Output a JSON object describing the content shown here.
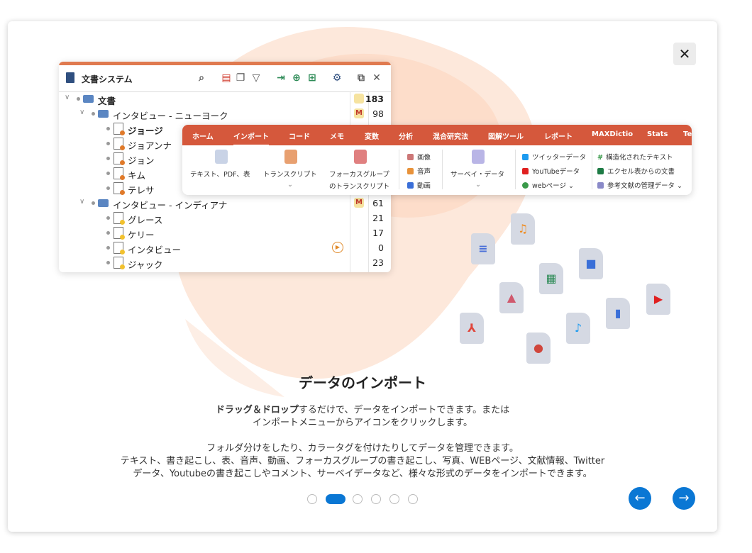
{
  "dialog": {
    "close_label": "✕",
    "heading": "データのインポート",
    "para1_bold": "ドラッグ＆ドロップ",
    "para1_rest": "するだけで、データをインポートできます。または",
    "para1_line2": "インポートメニューからアイコンをクリックします。",
    "para2_line1": "フォルダ分けをしたり、カラータグを付けたりしてデータを管理できます。",
    "para2_line2": "テキスト、書き起こし、表、音声、動画、フォーカスグループの書き起こし、写真、WEBページ、文献情報、Twitter",
    "para2_line3": "データ、Youtubeの書き起こしやコメント、サーベイデータなど、様々な形式のデータをインポートできます。",
    "prev_label": "←",
    "next_label": "→",
    "pagination": {
      "count": 6,
      "active_index": 1
    }
  },
  "doc_system": {
    "title": "文書システム",
    "rows": [
      {
        "label": "文書",
        "count": "183",
        "bold": true
      },
      {
        "label": "インタビュー - ニューヨーク",
        "count": "98"
      },
      {
        "label": "ジョージ",
        "count": "",
        "bold": true
      },
      {
        "label": "ジョアンナ",
        "count": ""
      },
      {
        "label": "ジョン",
        "count": ""
      },
      {
        "label": "キム",
        "count": ""
      },
      {
        "label": "テレサ",
        "count": ""
      },
      {
        "label": "インタビュー - インディアナ",
        "count": "61"
      },
      {
        "label": "グレース",
        "count": "21"
      },
      {
        "label": "ケリー",
        "count": "17"
      },
      {
        "label": "インタビュー",
        "count": "0"
      },
      {
        "label": "ジャック",
        "count": "23"
      }
    ]
  },
  "ribbon": {
    "tabs": [
      "ホーム",
      "インポート",
      "コード",
      "メモ",
      "変数",
      "分析",
      "混合研究法",
      "図解ツール",
      "レポート",
      "MAXDictio",
      "Stats",
      "Te"
    ],
    "active_tab": "インポート",
    "items": {
      "text_pdf": "テキスト、PDF、表",
      "transcript": "トランスクリプト",
      "focus_group_1": "フォーカスグループ",
      "focus_group_2": "のトランスクリプト",
      "image": "画像",
      "audio": "音声",
      "video": "動画",
      "survey": "サーベイ・データ",
      "twitter": "ツイッターデータ",
      "youtube": "YouTubeデータ",
      "web": "webページ",
      "structured": "構造化されたテキスト",
      "excel": "エクセル表からの文書",
      "reference": "参考文献の管理データ"
    }
  },
  "colors": {
    "accent": "#0a77d4",
    "ribbon": "#d5583c",
    "blob": "#fde3d3"
  }
}
